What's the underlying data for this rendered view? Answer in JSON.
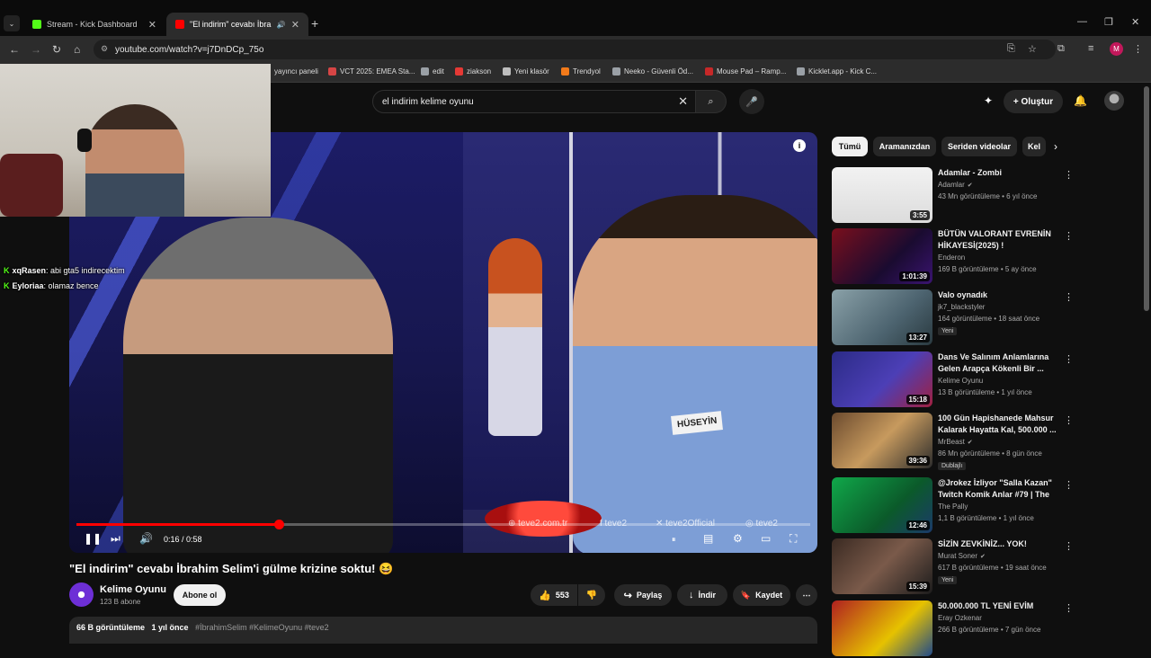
{
  "browser": {
    "tabs": [
      {
        "title": "Stream - Kick Dashboard",
        "color": "#53fc18"
      },
      {
        "title": "\"El indirim\" cevabı İbrahim",
        "color": "#ff0000"
      }
    ],
    "tab_list_glyph": "⌄",
    "newtab_glyph": "+",
    "close_glyph": "✕",
    "audio_glyph": "🔊",
    "window_buttons": [
      "—",
      "❐",
      "✕"
    ],
    "nav": {
      "back": "←",
      "forward": "→",
      "reload": "↻",
      "home": "⌂"
    },
    "url": "youtube.com/watch?v=j7DnDCp_75o",
    "url_icon": "⚙",
    "url_actions": [
      "⎘",
      "☆",
      "⧉",
      "≡",
      "⋮"
    ],
    "profile_initial": "M",
    "bookmarks": [
      {
        "label": "yayıncı paneli",
        "color": ""
      },
      {
        "label": "VCT 2025: EMEA Sta...",
        "color": "#d64545"
      },
      {
        "label": "edit",
        "color": "#9aa0a6"
      },
      {
        "label": "ziakson",
        "color": "#e53935"
      },
      {
        "label": "Yeni klasör",
        "color": "#bdbdbd"
      },
      {
        "label": "Trendyol",
        "color": "#f27a1a"
      },
      {
        "label": "Neeko - Güvenli Öd...",
        "color": "#9aa0a6"
      },
      {
        "label": "Mouse Pad – Ramp...",
        "color": "#c62828"
      },
      {
        "label": "Kicklet.app - Kick C...",
        "color": "#9aa0a6"
      }
    ]
  },
  "header": {
    "search_value": "el indirim kelime oyunu",
    "clear_glyph": "✕",
    "search_glyph": "⌕",
    "mic_glyph": "🎤",
    "create_label": "+ Oluştur",
    "premium_glyph": "✦",
    "bell_glyph": "🔔"
  },
  "overlay": {
    "chat": [
      {
        "user": "xqRasen",
        "message": ": abi gta5 indirecektim"
      },
      {
        "user": "Eyloriaa",
        "message": ": olamaz bence"
      }
    ],
    "kick_glyph": "K"
  },
  "player": {
    "name_tag": "HÜSEYİN",
    "watermarks": [
      "⊕ teve2.com.tr",
      "f teve2",
      "✕ teve2Official",
      "◎ teve2"
    ],
    "info_glyph": "i",
    "progress": 0.2759,
    "time_current": "0:16",
    "time_sep": " / ",
    "time_total": "0:58",
    "controls": {
      "pause": "❚❚",
      "next": "⏭",
      "volume": "🔊",
      "autoplay": "⏸",
      "subtitles": "▤",
      "settings": "⚙",
      "theater": "▭",
      "fullscreen": "⛶"
    }
  },
  "video": {
    "title": "\"El indirim\" cevabı İbrahim Selim'i gülme krizine soktu! 😆",
    "channel": "Kelime Oyunu",
    "subscribers": "123 B abone",
    "subscribe_label": "Abone ol",
    "likes": "553",
    "like_glyph": "👍",
    "dislike_glyph": "👎",
    "share_label": "Paylaş",
    "share_glyph": "↪",
    "download_label": "İndir",
    "download_glyph": "↓",
    "save_label": "Kaydet",
    "save_glyph": "🔖",
    "more_glyph": "⋯",
    "views": "66 B görüntüleme",
    "age": "1 yıl önce",
    "tags": "#İbrahimSelim #KelimeOyunu #teve2"
  },
  "sidebar": {
    "chips": [
      "Tümü",
      "Aramanızdan",
      "Seriden videolar",
      "Kel"
    ],
    "chip_next": "›",
    "more_glyph": "⋮",
    "verified_glyph": "✔",
    "recs": [
      {
        "title": "Adamlar - Zombi",
        "channel": "Adamlar",
        "verified": true,
        "meta": "43 Mn görüntüleme • 6 yıl önce",
        "duration": "3:55",
        "badge": "",
        "thumb": "linear-gradient(180deg,#f2f2f2,#dcdcdc)"
      },
      {
        "title": "BÜTÜN VALORANT EVRENİN HİKAYESİ(2025) !",
        "channel": "Enderon",
        "verified": false,
        "meta": "169 B görüntüleme • 5 ay önce",
        "duration": "1:01:39",
        "badge": "",
        "thumb": "linear-gradient(135deg,#7a0f1c,#1a0b30 60%,#3a1470)"
      },
      {
        "title": "Valo oynadık",
        "channel": "jk7_blackstyler",
        "verified": false,
        "meta": "164 görüntüleme • 18 saat önce",
        "duration": "13:27",
        "badge": "Yeni",
        "thumb": "linear-gradient(135deg,#8aa1a8,#4d6470 60%,#2a3a40)"
      },
      {
        "title": "Dans Ve Salınım Anlamlarına Gelen Arapça Kökenli Bir ...",
        "channel": "Kelime Oyunu",
        "verified": false,
        "meta": "13 B görüntüleme • 1 yıl önce",
        "duration": "15:18",
        "badge": "",
        "thumb": "linear-gradient(135deg,#2b2b86,#4c3fb6 55%,#a02040)"
      },
      {
        "title": "100 Gün Hapishanede Mahsur Kalarak Hayatta Kal, 500.000 ...",
        "channel": "MrBeast",
        "verified": true,
        "meta": "86 Mn görüntüleme • 8 gün önce",
        "duration": "39:36",
        "badge": "Dublajlı",
        "thumb": "linear-gradient(135deg,#6b4a2e,#c79a5e 50%,#2c2c2c)"
      },
      {
        "title": "@Jrokez İzliyor \"Salla Kazan\" Twitch Komik Anlar #79 | The ...",
        "channel": "The Pally",
        "verified": false,
        "meta": "1,1 B görüntüleme • 1 yıl önce",
        "duration": "12:46",
        "badge": "",
        "thumb": "linear-gradient(135deg,#10a84a,#0b5a2a 60%,#1b3a6a)"
      },
      {
        "title": "SİZİN ZEVKİNİZ... YOK!",
        "channel": "Murat Soner",
        "verified": true,
        "meta": "617 B görüntüleme • 19 saat önce",
        "duration": "15:39",
        "badge": "Yeni",
        "thumb": "linear-gradient(135deg,#3a2a22,#7a5a4a 50%,#1c1c1c)"
      },
      {
        "title": "50.000.000 TL YENİ EVİM",
        "channel": "Eray Ozkenar",
        "verified": false,
        "meta": "266 B görüntüleme • 7 gün önce",
        "duration": "",
        "badge": "",
        "thumb": "linear-gradient(135deg,#b02020,#e6c200 60%,#204a8a)"
      }
    ]
  }
}
